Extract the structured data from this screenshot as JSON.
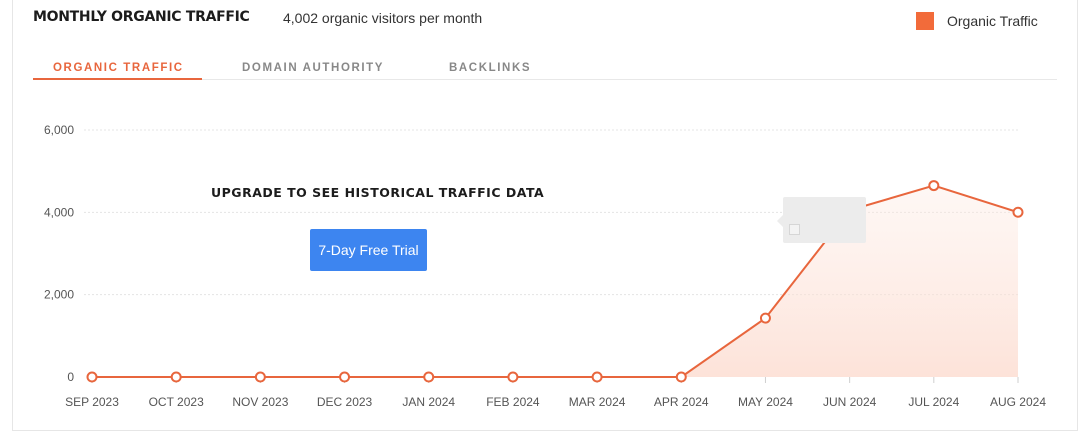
{
  "header": {
    "title": "MONTHLY ORGANIC TRAFFIC",
    "subtitle": "4,002 organic visitors per month"
  },
  "legend": {
    "label": "Organic Traffic",
    "color": "#f26b3a"
  },
  "tabs": [
    {
      "label": "ORGANIC TRAFFIC",
      "active": true
    },
    {
      "label": "DOMAIN AUTHORITY",
      "active": false
    },
    {
      "label": "BACKLINKS",
      "active": false
    }
  ],
  "overlay": {
    "upgrade_text": "UPGRADE TO SEE HISTORICAL TRAFFIC DATA",
    "button_label": "7-Day Free Trial"
  },
  "chart_data": {
    "type": "area",
    "categories": [
      "SEP 2023",
      "OCT 2023",
      "NOV 2023",
      "DEC 2023",
      "JAN 2024",
      "FEB 2024",
      "MAR 2024",
      "APR 2024",
      "MAY 2024",
      "JUN 2024",
      "JUL 2024",
      "AUG 2024"
    ],
    "series": [
      {
        "name": "Organic Traffic",
        "values": [
          0,
          0,
          0,
          0,
          0,
          0,
          0,
          0,
          1430,
          4050,
          4650,
          4002
        ]
      }
    ],
    "yticks": [
      0,
      2000,
      4000,
      6000
    ],
    "ytick_labels": [
      "0",
      "2,000",
      "4,000",
      "6,000"
    ],
    "ylim": [
      0,
      6000
    ],
    "grid": true,
    "legend_position": "top-right",
    "line_color": "#e8663d"
  }
}
